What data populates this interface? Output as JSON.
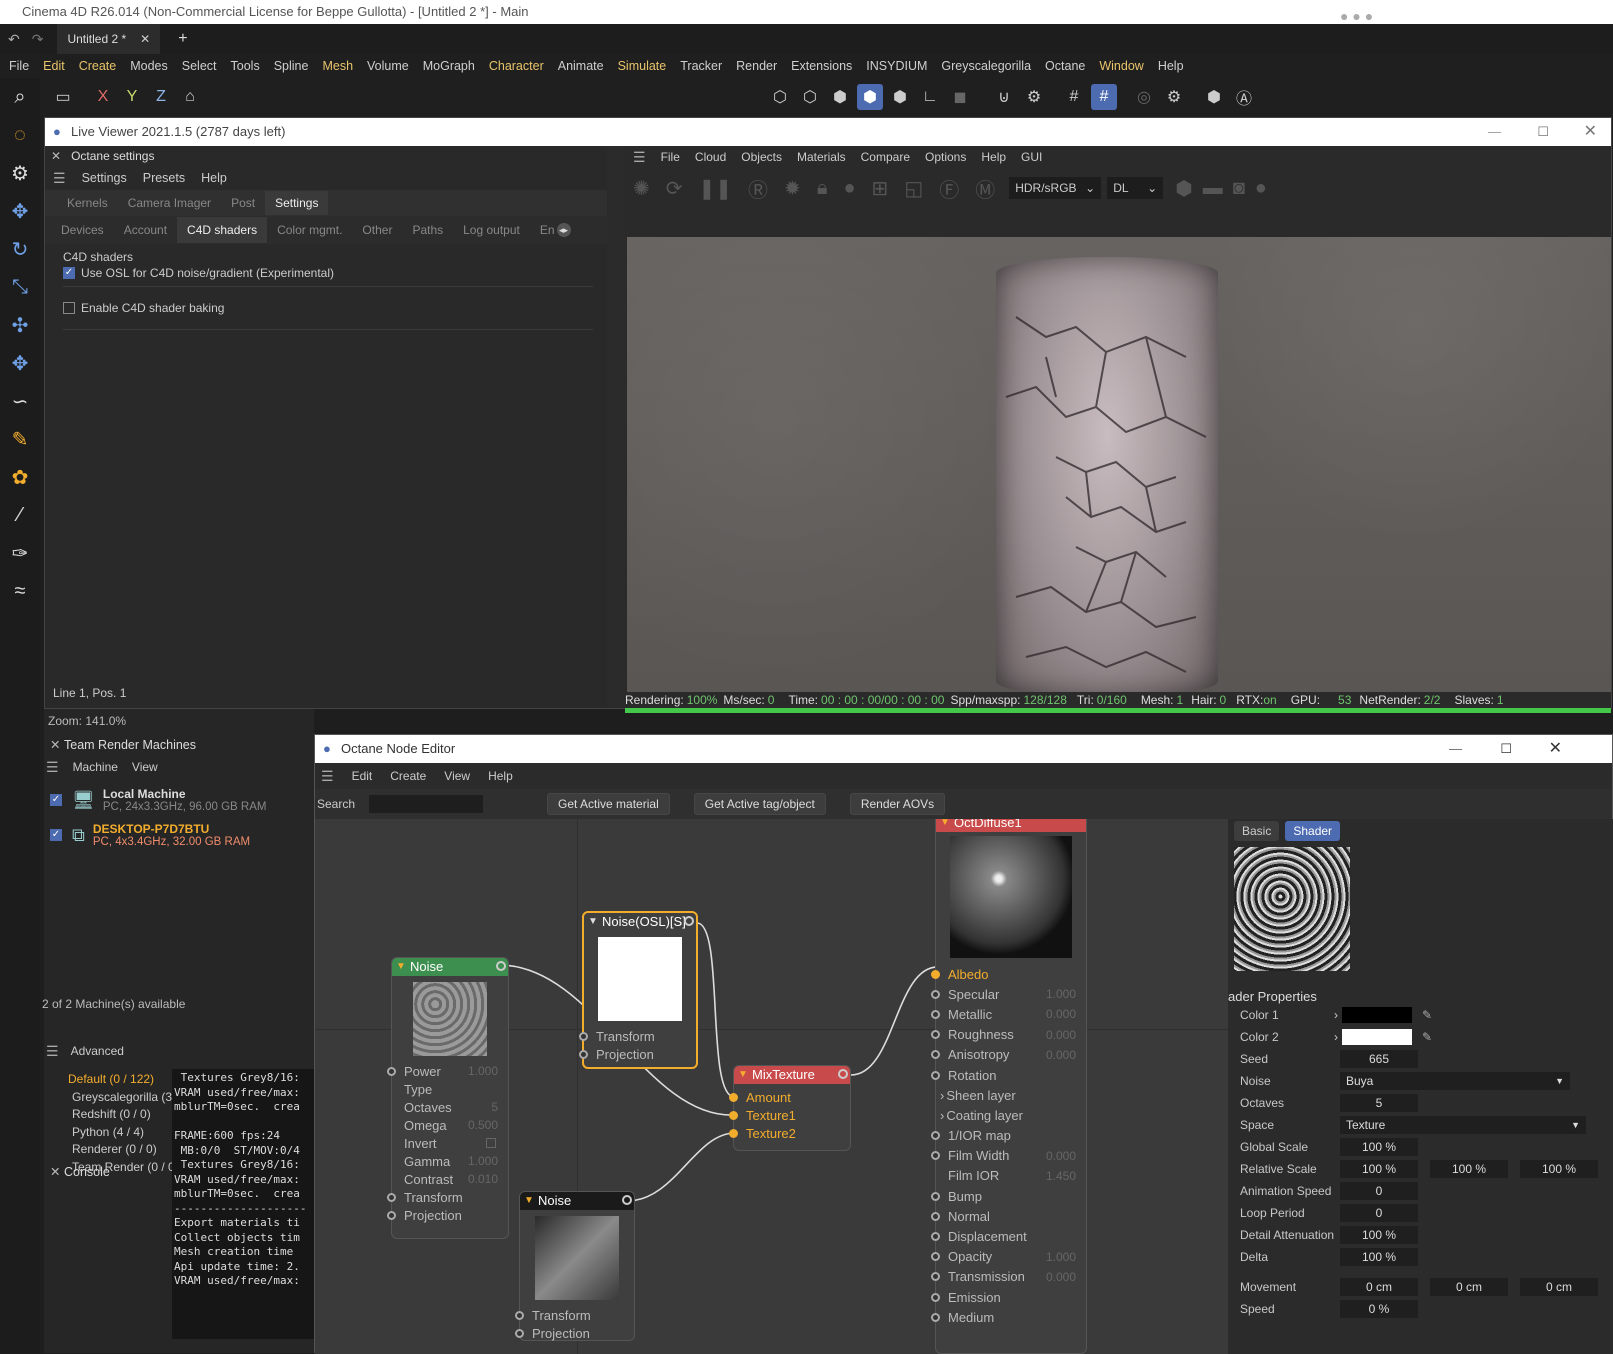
{
  "app": {
    "title": "Cinema 4D R26.014 (Non-Commercial License for Beppe Gullotta) - [Untitled 2 *] - Main",
    "tab": "Untitled 2 *",
    "menu": [
      "File",
      "Edit",
      "Create",
      "Modes",
      "Select",
      "Tools",
      "Spline",
      "Mesh",
      "Volume",
      "MoGraph",
      "Character",
      "Animate",
      "Simulate",
      "Tracker",
      "Render",
      "Extensions",
      "INSYDIUM",
      "Greyscalegorilla",
      "Octane",
      "Window",
      "Help"
    ],
    "axis_labels": [
      "X",
      "Y",
      "Z"
    ]
  },
  "live_viewer": {
    "title": "Live Viewer 2021.1.5 (2787 days left)",
    "menu": [
      "File",
      "Cloud",
      "Objects",
      "Materials",
      "Compare",
      "Options",
      "Help",
      "GUI"
    ],
    "colorspace": "HDR/sRGB",
    "kernel": "DL",
    "status": {
      "rendering_label": "Rendering:",
      "rendering": "100%",
      "mssec_label": "Ms/sec:",
      "mssec": "0",
      "time_label": "Time:",
      "time": "00 : 00 : 00/00 : 00 : 00",
      "spp_label": "Spp/maxspp:",
      "spp": "128/128",
      "tri_label": "Tri:",
      "tri": "0/160",
      "mesh_label": "Mesh:",
      "mesh": "1",
      "hair_label": "Hair:",
      "hair": "0",
      "rtx_label": "RTX:",
      "rtx": "on",
      "gpu_label": "GPU:",
      "gpu": "53",
      "netrender_label": "NetRender:",
      "netrender": "2/2",
      "slaves_label": "Slaves:",
      "slaves": "1"
    },
    "progress": 1.0
  },
  "octane_settings": {
    "title": "Octane settings",
    "menu": [
      "Settings",
      "Presets",
      "Help"
    ],
    "tabs": [
      "Kernels",
      "Camera Imager",
      "Post",
      "Settings"
    ],
    "subtabs": [
      "Devices",
      "Account",
      "C4D shaders",
      "Color mgmt.",
      "Other",
      "Paths",
      "Log output",
      "En"
    ],
    "section": "C4D shaders",
    "opt1": "Use OSL for C4D noise/gradient (Experimental)",
    "opt2": "Enable C4D shader baking",
    "footer": "Line 1, Pos. 1"
  },
  "zoom": "Zoom: 141.0%",
  "team_render": {
    "title": "Team Render Machines",
    "menu": [
      "Machine",
      "View"
    ],
    "machines": [
      {
        "name": "Local Machine",
        "info": "PC, 24x3.3GHz, 96.00 GB RAM"
      },
      {
        "name": "DESKTOP-P7D7BTU",
        "info": "PC, 4x3.4GHz, 32.00 GB RAM"
      }
    ],
    "footer": "2 of 2 Machine(s) available"
  },
  "console": {
    "title": "Console",
    "menu": "Advanced",
    "tree": [
      "Default (0 / 122)",
      "Greyscalegorilla (3-",
      "Redshift (0 / 0)",
      "Python (4 / 4)",
      "Renderer (0 / 0)",
      "Team Render  (0 / 0"
    ],
    "log": " Textures Grey8/16:\nVRAM used/free/max:\nmblurTM=0sec.  crea\n\nFRAME:600 fps:24\n MB:0/0  ST/MOV:0/4\n Textures Grey8/16:\nVRAM used/free/max:\nmblurTM=0sec.  crea\n--------------------\nExport materials ti\nCollect objects tim\nMesh creation time \nApi update time: 2.\nVRAM used/free/max:"
  },
  "node_editor": {
    "title": "Octane Node Editor",
    "menu": [
      "Edit",
      "Create",
      "View",
      "Help"
    ],
    "search_label": "Search",
    "buttons": [
      "Get Active material",
      "Get Active tag/object",
      "Render AOVs"
    ],
    "nodes": {
      "noise1": {
        "title": "Noise",
        "ports": [
          {
            "l": "Power",
            "v": "1.000"
          },
          {
            "l": "Type",
            "v": ""
          },
          {
            "l": "Octaves",
            "v": "5"
          },
          {
            "l": "Omega",
            "v": "0.500"
          },
          {
            "l": "Invert",
            "v": ""
          },
          {
            "l": "Gamma",
            "v": "1.000"
          },
          {
            "l": "Contrast",
            "v": "0.010"
          },
          {
            "l": "Transform",
            "v": ""
          },
          {
            "l": "Projection",
            "v": ""
          }
        ]
      },
      "osl": {
        "title": "Noise(OSL)[S]",
        "ports": [
          "Transform",
          "Projection"
        ]
      },
      "mix": {
        "title": "MixTexture",
        "ports": [
          "Amount",
          "Texture1",
          "Texture2"
        ]
      },
      "noise2": {
        "title": "Noise",
        "ports": [
          "Transform",
          "Projection"
        ]
      },
      "diffuse": {
        "title": "OctDiffuse1",
        "ports": [
          {
            "l": "Albedo",
            "v": ""
          },
          {
            "l": "Specular",
            "v": "1.000"
          },
          {
            "l": "Metallic",
            "v": "0.000"
          },
          {
            "l": "Roughness",
            "v": "0.000"
          },
          {
            "l": "Anisotropy",
            "v": "0.000"
          },
          {
            "l": "Rotation",
            "v": ""
          },
          {
            "l": "Sheen layer",
            "v": ""
          },
          {
            "l": "Coating layer",
            "v": ""
          },
          {
            "l": "1/IOR map",
            "v": ""
          },
          {
            "l": "Film Width",
            "v": "0.000"
          },
          {
            "l": "Film IOR",
            "v": "1.450"
          },
          {
            "l": "Bump",
            "v": ""
          },
          {
            "l": "Normal",
            "v": ""
          },
          {
            "l": "Displacement",
            "v": ""
          },
          {
            "l": "Opacity",
            "v": "1.000"
          },
          {
            "l": "Transmission",
            "v": "0.000"
          },
          {
            "l": "Emission",
            "v": ""
          },
          {
            "l": "Medium",
            "v": ""
          }
        ]
      }
    },
    "props": {
      "tabs": [
        "Basic",
        "Shader"
      ],
      "section": "ader Properties",
      "color1": "Color 1",
      "color2": "Color 2",
      "seed_label": "Seed",
      "seed": "665",
      "noise_label": "Noise",
      "noise": "Buya",
      "octaves_label": "Octaves",
      "octaves": "5",
      "space_label": "Space",
      "space": "Texture",
      "global_scale_label": "Global Scale",
      "global_scale": "100 %",
      "relative_scale_label": "Relative Scale",
      "relative_scale": [
        "100 %",
        "100 %",
        "100 %"
      ],
      "anim_speed_label": "Animation Speed",
      "anim_speed": "0",
      "loop_label": "Loop Period",
      "loop": "0",
      "detail_label": "Detail Attenuation",
      "detail": "100 %",
      "delta_label": "Delta",
      "delta": "100 %",
      "movement_label": "Movement",
      "movement": [
        "0 cm",
        "0 cm",
        "0 cm"
      ],
      "speed_label": "Speed",
      "speed": "0 %"
    }
  },
  "colors": {
    "accent": "#4d6bb0",
    "orange": "#f3ad2d",
    "green": "#44c84b",
    "node_noise": "#3d8f4f",
    "node_mix": "#c94a4a"
  }
}
